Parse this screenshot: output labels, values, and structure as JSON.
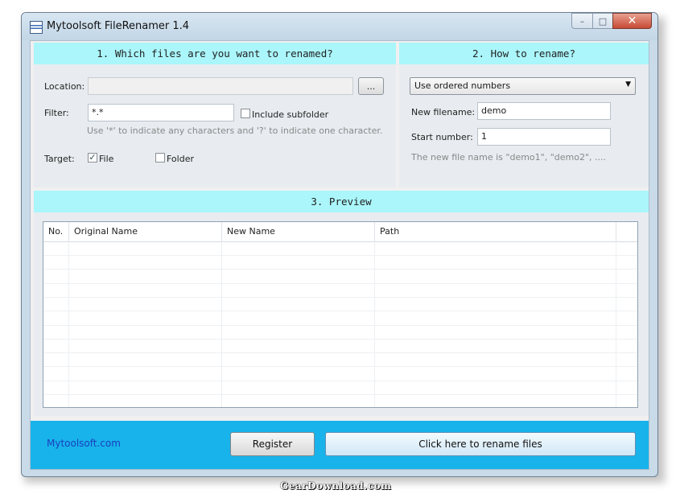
{
  "window": {
    "title": "Mytoolsoft FileRenamer 1.4",
    "min_icon": "minimize-icon",
    "max_icon": "maximize-icon",
    "close_icon": "close-icon"
  },
  "section1": {
    "header": "1. Which files are you want to renamed?",
    "location_label": "Location:",
    "location_value": "",
    "browse_label": "...",
    "filter_label": "Filter:",
    "filter_value": "*.*",
    "include_subfolder_label": "Include subfolder",
    "include_subfolder_checked": false,
    "filter_hint": "Use '*' to indicate any characters and '?' to indicate one character.",
    "target_label": "Target:",
    "file_label": "File",
    "file_checked": true,
    "folder_label": "Folder",
    "folder_checked": false
  },
  "section2": {
    "header": "2. How to rename?",
    "method_value": "Use ordered numbers",
    "new_filename_label": "New filename:",
    "new_filename_value": "demo",
    "start_number_label": "Start number:",
    "start_number_value": "1",
    "hint": "The new file name is \"demo1\", \"demo2\", ...."
  },
  "section3": {
    "header": "3. Preview",
    "columns": [
      "No.",
      "Original Name",
      "New Name",
      "Path"
    ]
  },
  "footer": {
    "link": "Mytoolsoft.com",
    "register_label": "Register",
    "rename_label": "Click here to rename files"
  },
  "watermark": "GearDownload.com",
  "colors": {
    "section_header": "#aaf6fb",
    "footer_bg": "#18b3eb",
    "link": "#1a3fbf"
  }
}
